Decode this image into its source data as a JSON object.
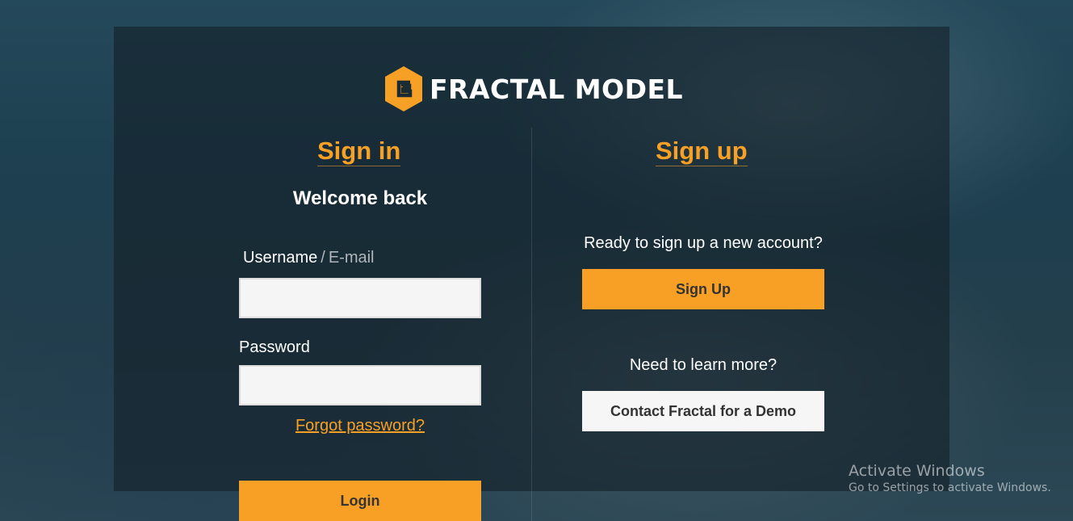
{
  "logo": {
    "text": "FRACTAL MODEL",
    "icon": "hexagon-e-logo-icon",
    "color": "#f6a025"
  },
  "signin": {
    "heading": "Sign in",
    "welcome": "Welcome back",
    "username_label": "Username",
    "username_separator": "/",
    "username_alt_label": "E-mail",
    "username_value": "",
    "password_label": "Password",
    "password_value": "",
    "forgot_link": "Forgot password?",
    "login_button": "Login"
  },
  "signup": {
    "heading": "Sign up",
    "ready_text": "Ready to sign up a new account?",
    "signup_button": "Sign Up",
    "learn_text": "Need to learn more?",
    "demo_button": "Contact Fractal for a Demo"
  },
  "watermark": {
    "title": "Activate Windows",
    "subtitle": "Go to Settings to activate Windows."
  },
  "colors": {
    "accent": "#f6a025",
    "button_orange": "#f8a026",
    "button_white": "#f6f6f6",
    "input_bg": "#f5f5f5"
  }
}
